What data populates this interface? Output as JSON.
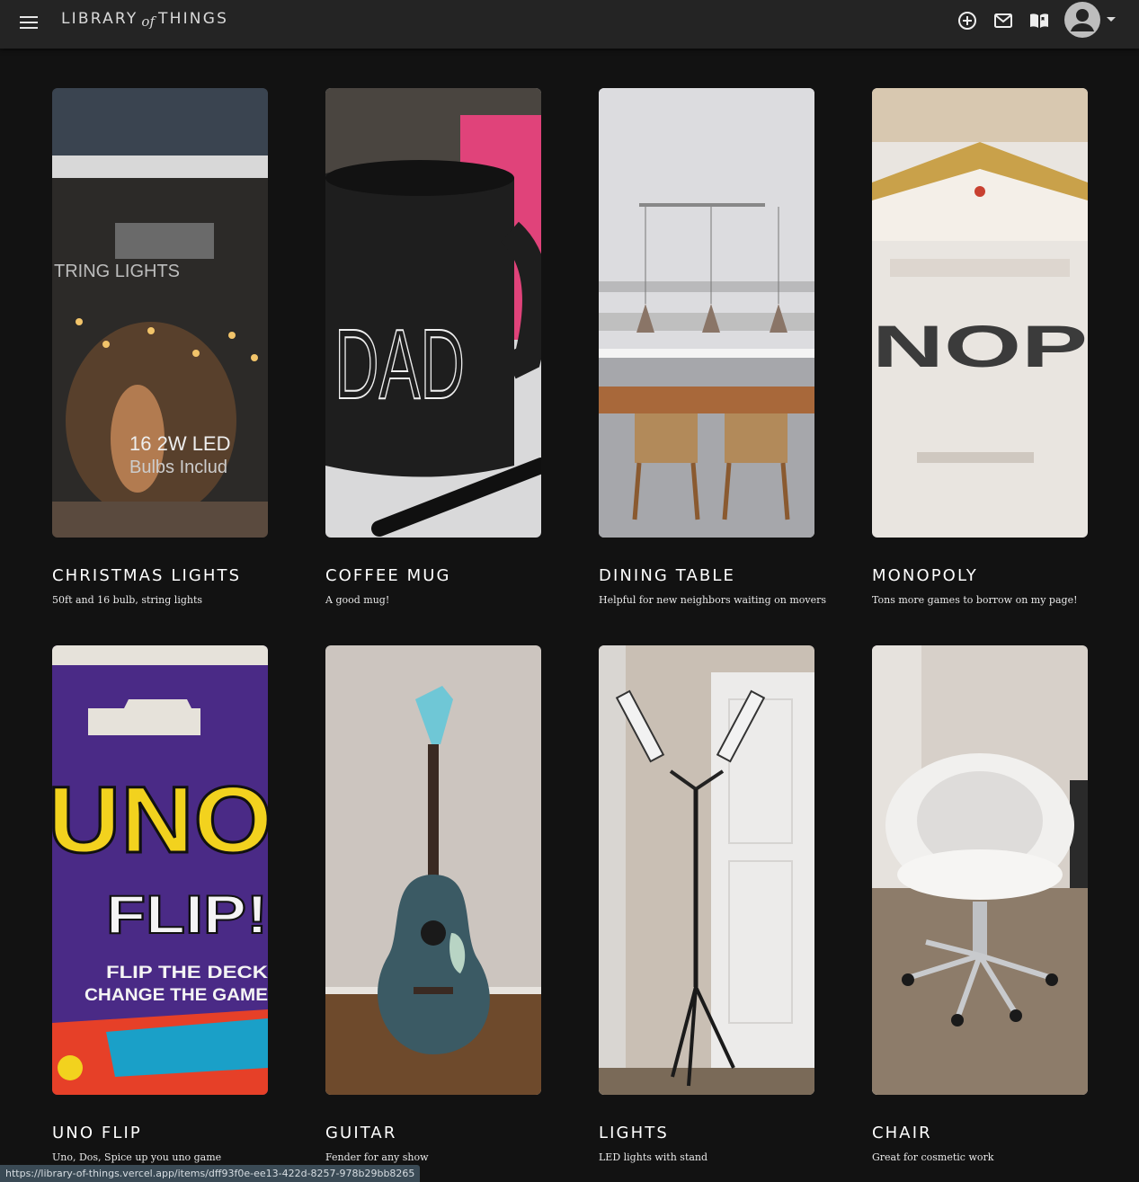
{
  "header": {
    "brand_left": "LIBRARY",
    "brand_of": "of",
    "brand_right": "THINGS"
  },
  "items": [
    {
      "title": "CHRISTMAS LIGHTS",
      "description": "50ft and 16 bulb, string lights",
      "image_text": "TRING LIGHTS",
      "image_text2": "16 2W LED",
      "image_text3": "Bulbs Includ"
    },
    {
      "title": "COFFEE MUG",
      "description": "A good mug!",
      "image_text": "DAD"
    },
    {
      "title": "DINING TABLE",
      "description": "Helpful for new neighbors waiting on movers"
    },
    {
      "title": "MONOPOLY",
      "description": "Tons more games to borrow on my page!",
      "image_text": "NOP"
    },
    {
      "title": "UNO FLIP",
      "description": "Uno, Dos, Spice up you uno game",
      "image_text": "UNO",
      "image_text2": "FLIP!",
      "image_text3": "FLIP THE DECK",
      "image_text4": "CHANGE THE GAME"
    },
    {
      "title": "GUITAR",
      "description": "Fender for any show"
    },
    {
      "title": "LIGHTS",
      "description": "LED lights with stand"
    },
    {
      "title": "CHAIR",
      "description": "Great for cosmetic work"
    }
  ],
  "status_bar": {
    "url": "https://library-of-things.vercel.app/items/dff93f0e-ee13-422d-8257-978b29bb8265"
  }
}
